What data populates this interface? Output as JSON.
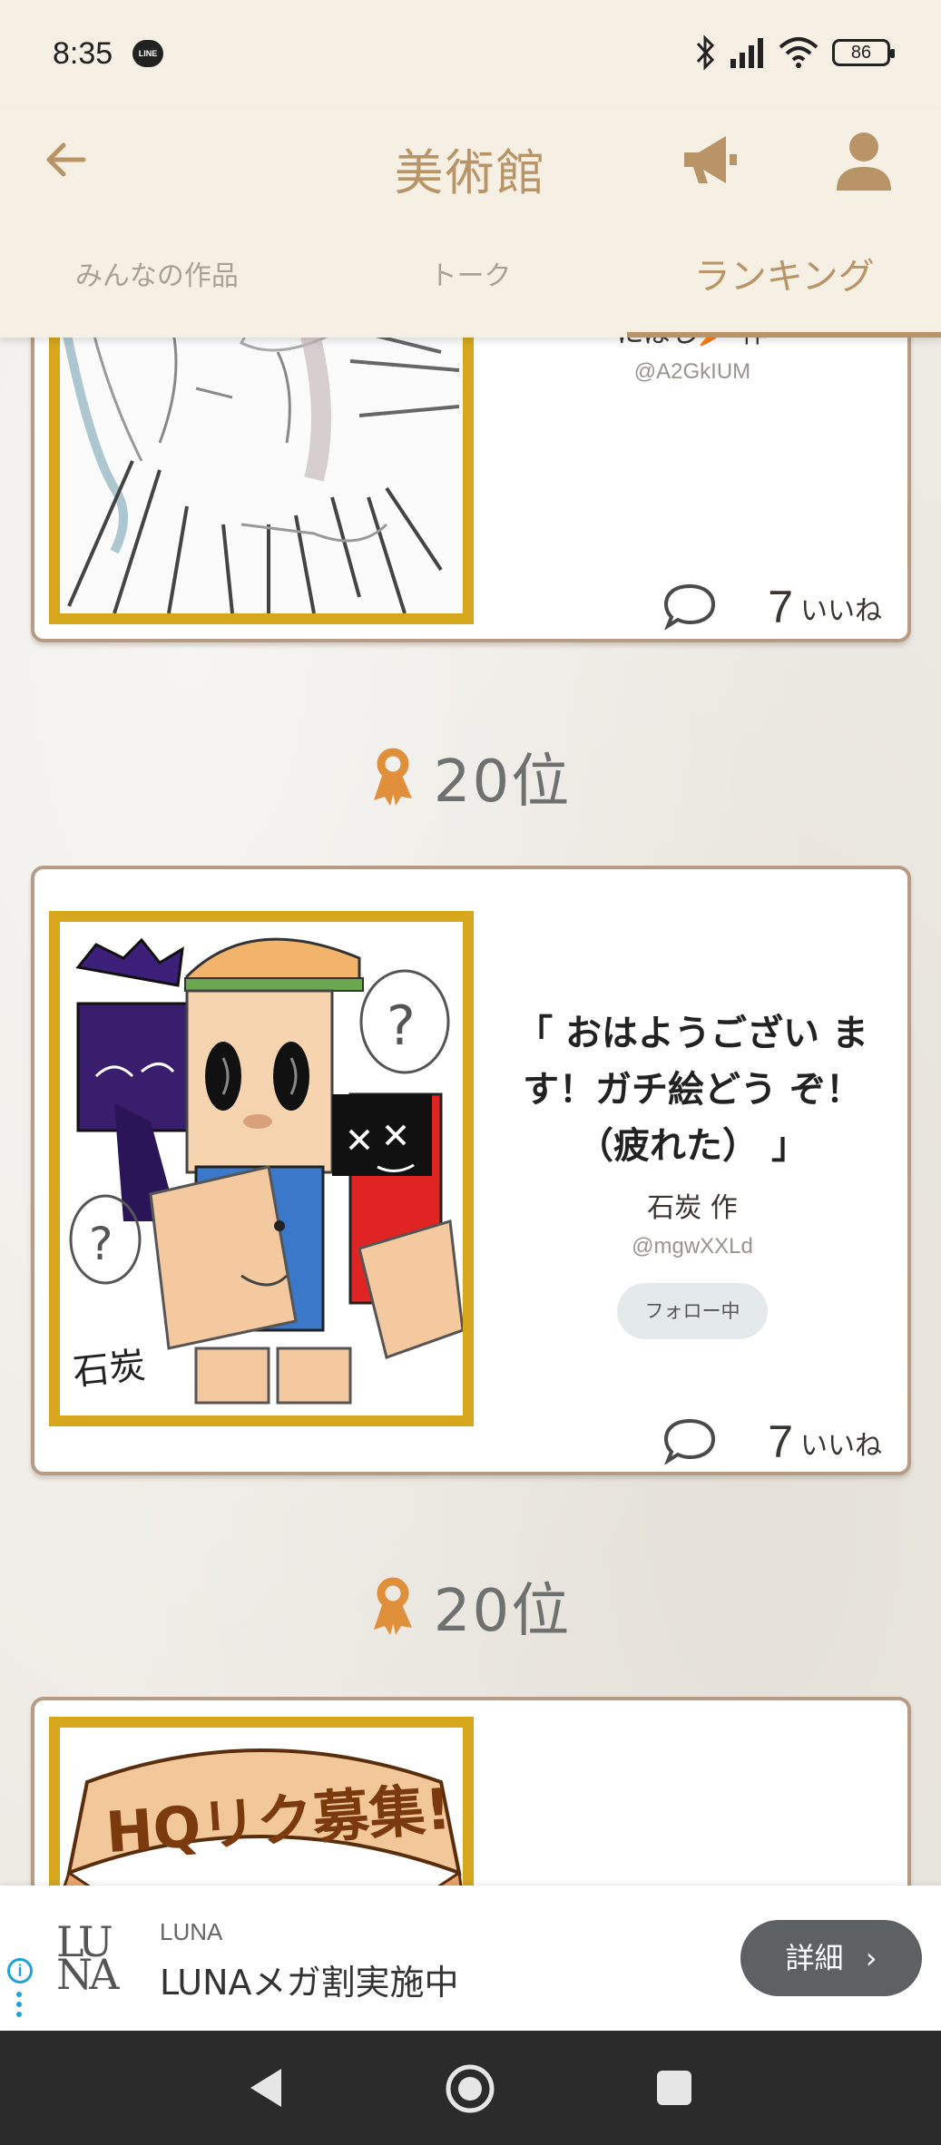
{
  "status_bar": {
    "time": "8:35",
    "line_badge": "LINE",
    "battery": "86"
  },
  "header": {
    "title": "美術館",
    "tabs": [
      {
        "label": "みんなの作品",
        "active": false
      },
      {
        "label": "トーク",
        "active": false
      },
      {
        "label": "ランキング",
        "active": true
      }
    ]
  },
  "posts": [
    {
      "title": "",
      "author": "にぼし🥕 作",
      "handle": "@A2GkIUM",
      "likes": "7",
      "likes_label": "いいね"
    },
    {
      "rank": "20位",
      "title": "「 おはようござい ます！ガチ絵どう ぞ！（疲れた） 」",
      "author": "石炭 作",
      "handle": "@mgwXXLd",
      "follow_label": "フォロー中",
      "likes": "7",
      "likes_label": "いいね",
      "signature": "石炭"
    },
    {
      "rank": "20位",
      "art_text": "HQリク募集!"
    }
  ],
  "ad": {
    "logo": "LUNA",
    "sponsor": "LUNA",
    "title": "LUNAメガ割実施中",
    "button": "詳細",
    "info": "i"
  },
  "colors": {
    "accent": "#b89466",
    "frame": "#d6a71c",
    "header_bg": "#f6efe4"
  }
}
